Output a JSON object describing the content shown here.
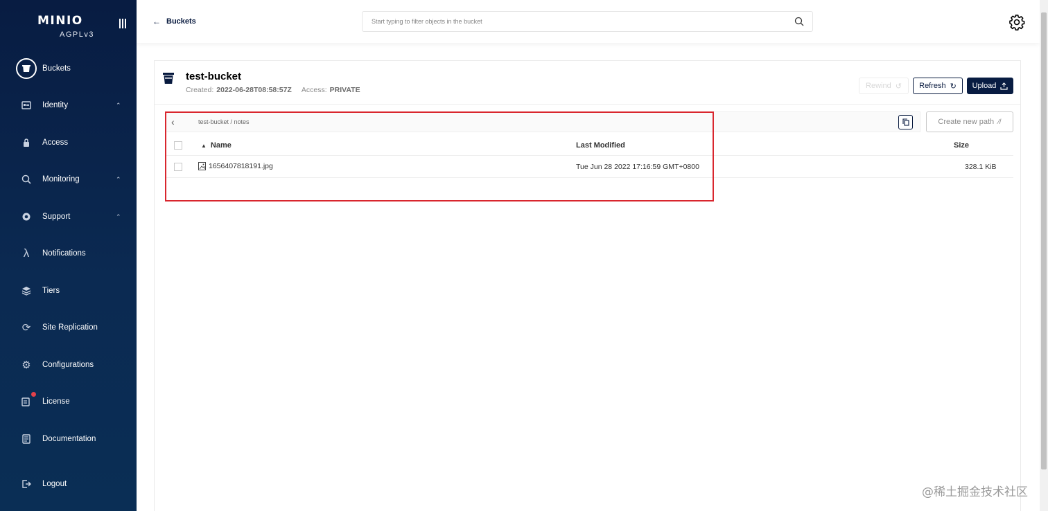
{
  "sidebar": {
    "logo": "MINIO",
    "license_tag": "AGPLv3",
    "items": [
      {
        "label": "Buckets"
      },
      {
        "label": "Identity"
      },
      {
        "label": "Access"
      },
      {
        "label": "Monitoring"
      },
      {
        "label": "Support"
      },
      {
        "label": "Notifications"
      },
      {
        "label": "Tiers"
      },
      {
        "label": "Site Replication"
      },
      {
        "label": "Configurations"
      },
      {
        "label": "License"
      },
      {
        "label": "Documentation"
      },
      {
        "label": "Logout"
      }
    ],
    "active_item": "Buckets"
  },
  "topbar": {
    "back_label": "Buckets",
    "search_placeholder": "Start typing to filter objects in the bucket"
  },
  "bucket": {
    "name": "test-bucket",
    "created_label": "Created:",
    "created_value": "2022-06-28T08:58:57Z",
    "access_label": "Access:",
    "access_value": "PRIVATE",
    "rewind_label": "Rewind",
    "refresh_label": "Refresh",
    "upload_label": "Upload"
  },
  "browser": {
    "path": "test-bucket  /  notes",
    "create_path_label": "Create new path",
    "columns": {
      "name": "Name",
      "modified": "Last Modified",
      "size": "Size"
    },
    "rows": [
      {
        "name": "1656407818191.jpg",
        "modified": "Tue Jun 28 2022 17:16:59 GMT+0800",
        "size": "328.1 KiB"
      }
    ]
  },
  "watermark": "@稀土掘金技术社区",
  "colors": {
    "sidebar_bg": "#081c42",
    "primary": "#07193e",
    "highlight": "#d9262e",
    "notification_dot": "#e3414b"
  }
}
